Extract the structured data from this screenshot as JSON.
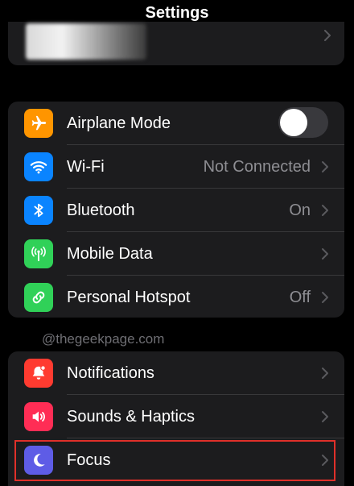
{
  "nav": {
    "title": "Settings"
  },
  "watermark": "@thegeekpage.com",
  "colors": {
    "airplane": "#ff9500",
    "wifi": "#0a84ff",
    "bluetooth": "#0a84ff",
    "mobile": "#30d158",
    "hotspot": "#30d158",
    "notifications": "#ff3b30",
    "sounds": "#ff2d55",
    "focus": "#5e5ce6",
    "highlight": "#e0302a"
  },
  "connectivity": {
    "airplane": {
      "label": "Airplane Mode",
      "icon": "airplane-icon",
      "toggle": "off"
    },
    "wifi": {
      "label": "Wi-Fi",
      "value": "Not Connected",
      "icon": "wifi-icon"
    },
    "bluetooth": {
      "label": "Bluetooth",
      "value": "On",
      "icon": "bluetooth-icon"
    },
    "mobile": {
      "label": "Mobile Data",
      "icon": "antenna-icon"
    },
    "hotspot": {
      "label": "Personal Hotspot",
      "value": "Off",
      "icon": "link-icon"
    }
  },
  "alerts": {
    "notifications": {
      "label": "Notifications",
      "icon": "bell-icon"
    },
    "sounds": {
      "label": "Sounds & Haptics",
      "icon": "speaker-icon"
    },
    "focus": {
      "label": "Focus",
      "icon": "moon-icon"
    }
  }
}
